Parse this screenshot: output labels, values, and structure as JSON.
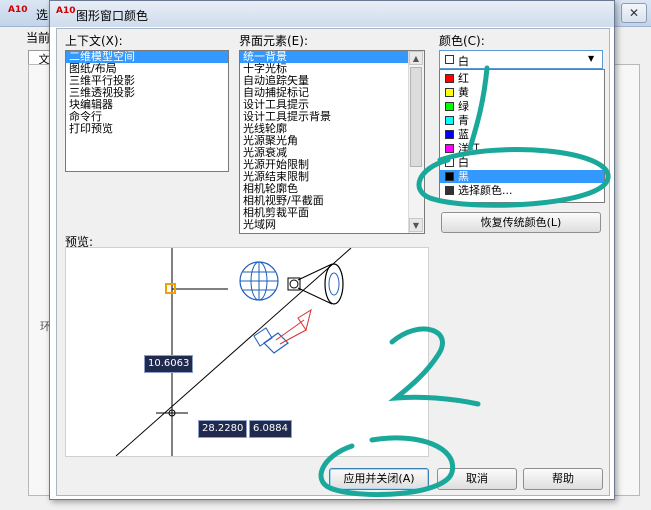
{
  "background_window": {
    "title": "选",
    "label": "当前",
    "tab": "文",
    "close": "✕",
    "marker": "环"
  },
  "dialog": {
    "title": "图形窗口颜色",
    "icon": "A10"
  },
  "context": {
    "label": "上下文(X):",
    "items": [
      "二维模型空间",
      "图纸/布局",
      "三维平行投影",
      "三维透视投影",
      "块编辑器",
      "命令行",
      "打印预览"
    ],
    "selected": 0
  },
  "elements": {
    "label": "界面元素(E):",
    "items": [
      "统一背景",
      "十字光标",
      "自动追踪矢量",
      "自动捕捉标记",
      "设计工具提示",
      "设计工具提示背景",
      "光线轮廓",
      "光源聚光角",
      "光源衰减",
      "光源开始限制",
      "光源结束限制",
      "相机轮廓色",
      "相机视野/平截面",
      "相机剪裁平面",
      "光域网"
    ],
    "selected": 0
  },
  "color": {
    "label": "颜色(C):",
    "selected_value": "白",
    "options": [
      {
        "name": "红",
        "color": "#ff0000"
      },
      {
        "name": "黄",
        "color": "#ffff00"
      },
      {
        "name": "绿",
        "color": "#00ff00"
      },
      {
        "name": "青",
        "color": "#00ffff"
      },
      {
        "name": "蓝",
        "color": "#0000ff"
      },
      {
        "name": "洋红",
        "color": "#ff00ff"
      },
      {
        "name": "白",
        "color": "#ffffff"
      },
      {
        "name": "黑",
        "color": "#000000"
      },
      {
        "name": "选择颜色...",
        "color": "#333333"
      }
    ],
    "highlighted_index": 7
  },
  "buttons": {
    "restore": "恢复传统颜色(L)",
    "apply_close": "应用并关闭(A)",
    "cancel": "取消",
    "help": "帮助"
  },
  "preview": {
    "label": "预览:",
    "dim1": "10.6063",
    "dim2": "28.2280",
    "dim3": "6.0884"
  },
  "annotations": {
    "number_2": "2",
    "accent": "#1aa89a"
  }
}
